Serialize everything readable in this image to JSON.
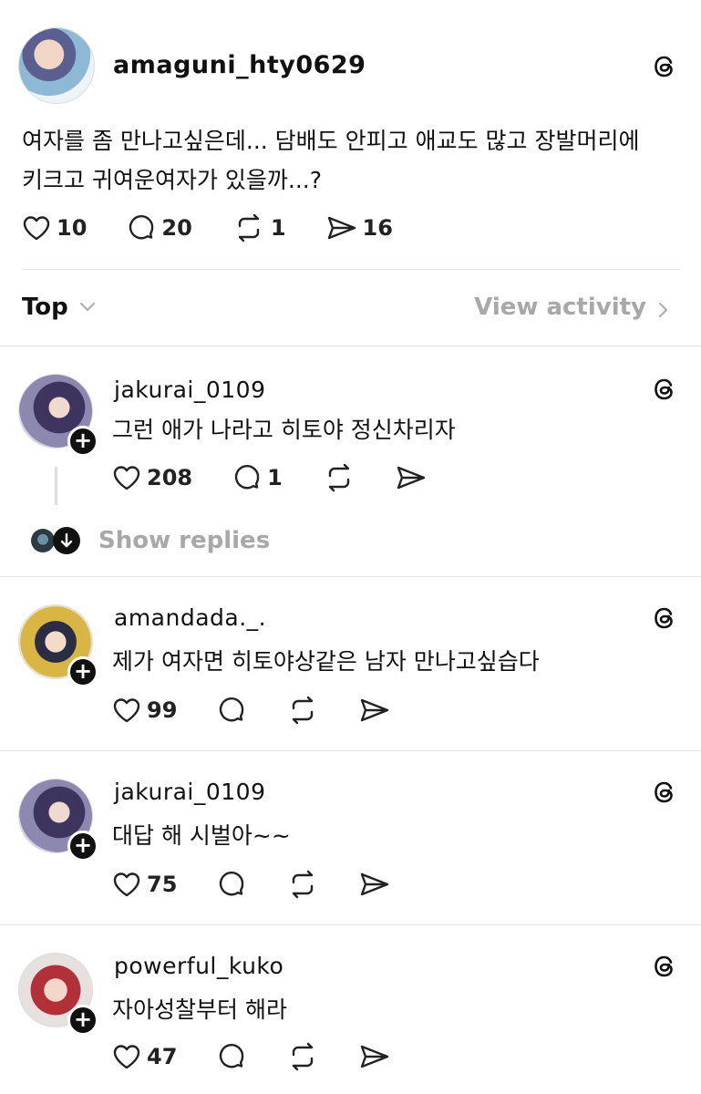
{
  "post": {
    "username": "amaguni_hty0629",
    "text_line1": "여자를 좀 만나고싶은데... 담배도 안피고 애교도 많고 장발머리에",
    "text_line2": "키크고 귀여운여자가 있을까...?",
    "likes": "10",
    "comments": "20",
    "reposts": "1",
    "shares": "16"
  },
  "sort": {
    "label": "Top",
    "view_activity": "View activity"
  },
  "replies": [
    {
      "username": "jakurai_0109",
      "text": "그런 애가 나라고 히토야 정신차리자",
      "likes": "208",
      "comments": "1"
    },
    {
      "username": "amandada._.",
      "text": "제가 여자면 히토야상같은 남자 만나고싶습다",
      "likes": "99"
    },
    {
      "username": "jakurai_0109",
      "text": "대답 해 시벌아~~",
      "likes": "75"
    },
    {
      "username": "powerful_kuko",
      "text": "자아성찰부터 해라",
      "likes": "47"
    }
  ],
  "show_replies": "Show replies",
  "icons": {
    "like": "heart-icon",
    "comment": "comment-icon",
    "repost": "repost-icon",
    "share": "send-icon",
    "threads": "threads-logo-icon",
    "follow": "plus-icon"
  },
  "colors": {
    "text": "#111111",
    "muted": "#a8a8a8",
    "divider": "#e3e3e3"
  }
}
